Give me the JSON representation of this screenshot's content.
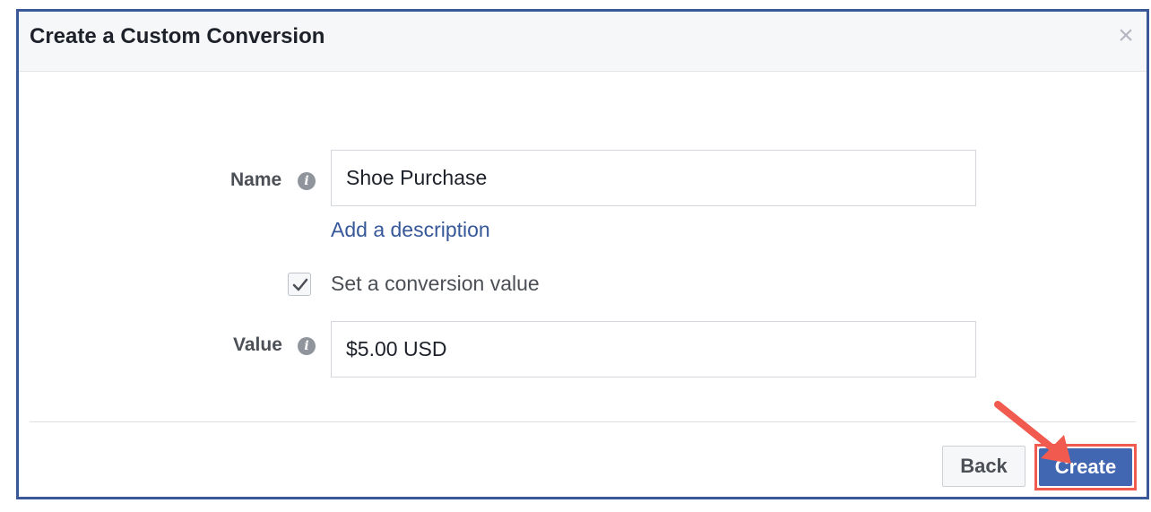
{
  "dialog": {
    "title": "Create a Custom Conversion",
    "close_symbol": "×"
  },
  "form": {
    "name_label": "Name",
    "name_value": "Shoe Purchase",
    "add_description_link": "Add a description",
    "conversion_value_checkbox_label": "Set a conversion value",
    "conversion_value_checked": true,
    "value_label": "Value",
    "value_value": "$5.00 USD",
    "info_glyph": "i"
  },
  "footer": {
    "back_label": "Back",
    "create_label": "Create"
  },
  "icons": {
    "info": "info-icon",
    "close": "close-icon",
    "check": "check-icon",
    "arrow": "arrow-annotation-icon"
  },
  "colors": {
    "dialog_border": "#3b5998",
    "link": "#365899",
    "primary_button": "#4267b2",
    "highlight": "#f05a4f"
  }
}
